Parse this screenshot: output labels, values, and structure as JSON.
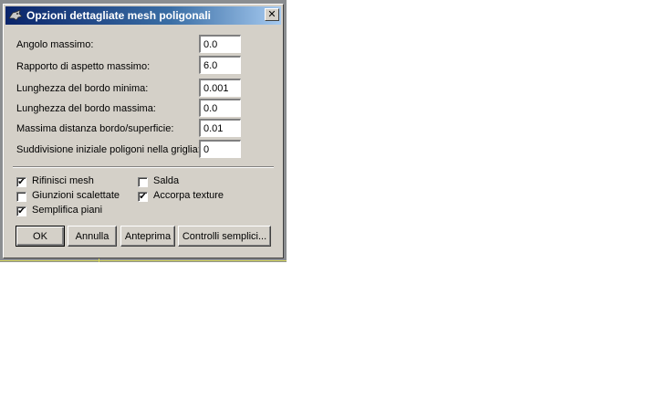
{
  "window": {
    "title": "Opzioni dettagliate mesh poligonali",
    "app_icon": "rhino-icon",
    "close_glyph": "✕"
  },
  "fields": [
    {
      "label": "Angolo massimo:",
      "value": "0.0"
    },
    {
      "label": "Rapporto di aspetto massimo:",
      "value": "6.0"
    },
    {
      "label": "Lunghezza del bordo minima:",
      "value": "0.001"
    },
    {
      "label": "Lunghezza del bordo massima:",
      "value": "0.0"
    },
    {
      "label": "Massima distanza bordo/superficie:",
      "value": "0.01"
    },
    {
      "label": "Suddivisione iniziale poligoni nella griglia:",
      "value": "0"
    }
  ],
  "checkboxes": [
    {
      "label": "Rifinisci mesh",
      "checked": true
    },
    {
      "label": "Giunzioni scalettate",
      "checked": false
    },
    {
      "label": "Semplifica piani",
      "checked": true
    },
    {
      "label": "Salda",
      "checked": false
    },
    {
      "label": "Accorpa texture",
      "checked": true
    }
  ],
  "buttons": {
    "ok": "OK",
    "cancel": "Annulla",
    "preview": "Anteprima",
    "simple": "Controlli semplici..."
  },
  "check_glyph": "✔",
  "colors": {
    "dialog_bg": "#d4d0c8",
    "titlebar_start": "#0a246a",
    "titlebar_end": "#a6caf0",
    "viewport_bg": "#8a8d90",
    "grid_line": "#d8d858"
  }
}
